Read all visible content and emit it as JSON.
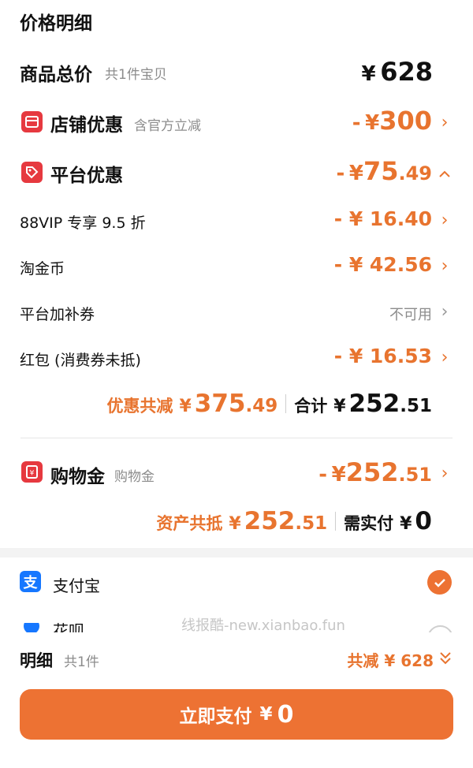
{
  "header": {
    "title": "价格明细"
  },
  "goods_total": {
    "label": "商品总价",
    "sub": "共1件宝贝",
    "sym": "¥",
    "amount": "628"
  },
  "store_discount": {
    "label": "店铺优惠",
    "sub": "含官方立减",
    "minus": "-",
    "sym": "¥",
    "amount": "300"
  },
  "platform_discount": {
    "label": "平台优惠",
    "minus": "-",
    "sym": "¥",
    "amount_int": "75",
    "amount_dec": ".49"
  },
  "sub_items": [
    {
      "label": "88VIP 专享 9.5 折",
      "value": "- ¥ 16.40"
    },
    {
      "label": "淘金币",
      "value": "- ¥ 42.56"
    },
    {
      "label": "平台加补券",
      "value": "不可用"
    },
    {
      "label": "红包 (消费券未抵)",
      "value": "- ¥ 16.53"
    }
  ],
  "discount_summary": {
    "label": "优惠共减",
    "sym": "¥",
    "amount_int": "375",
    "amount_dec": ".49",
    "total_label": "合计",
    "total_sym": "¥",
    "total_int": "252",
    "total_dec": ".51"
  },
  "shopping_gold": {
    "label": "购物金",
    "sub": "购物金",
    "minus": "-",
    "sym": "¥",
    "amount_int": "252",
    "amount_dec": ".51"
  },
  "asset_summary": {
    "label": "资产共抵",
    "sym": "¥",
    "amount_int": "252",
    "amount_dec": ".51",
    "pay_label": "需实付",
    "pay_sym": "¥",
    "pay_amount": "0"
  },
  "payment": {
    "method": "支付宝",
    "method2_partial": "花呗"
  },
  "watermark": "线报酷-new.xianbao.fun",
  "footer": {
    "label": "明细",
    "sub": "共1件",
    "saved_label": "共减",
    "saved_value": "¥ 628"
  },
  "pay_button": {
    "label": "立即支付",
    "sym": "¥",
    "amount": "0"
  },
  "colors": {
    "accent": "#ed7233",
    "icon_red": "#e6393f",
    "alipay_blue": "#1677ff"
  }
}
